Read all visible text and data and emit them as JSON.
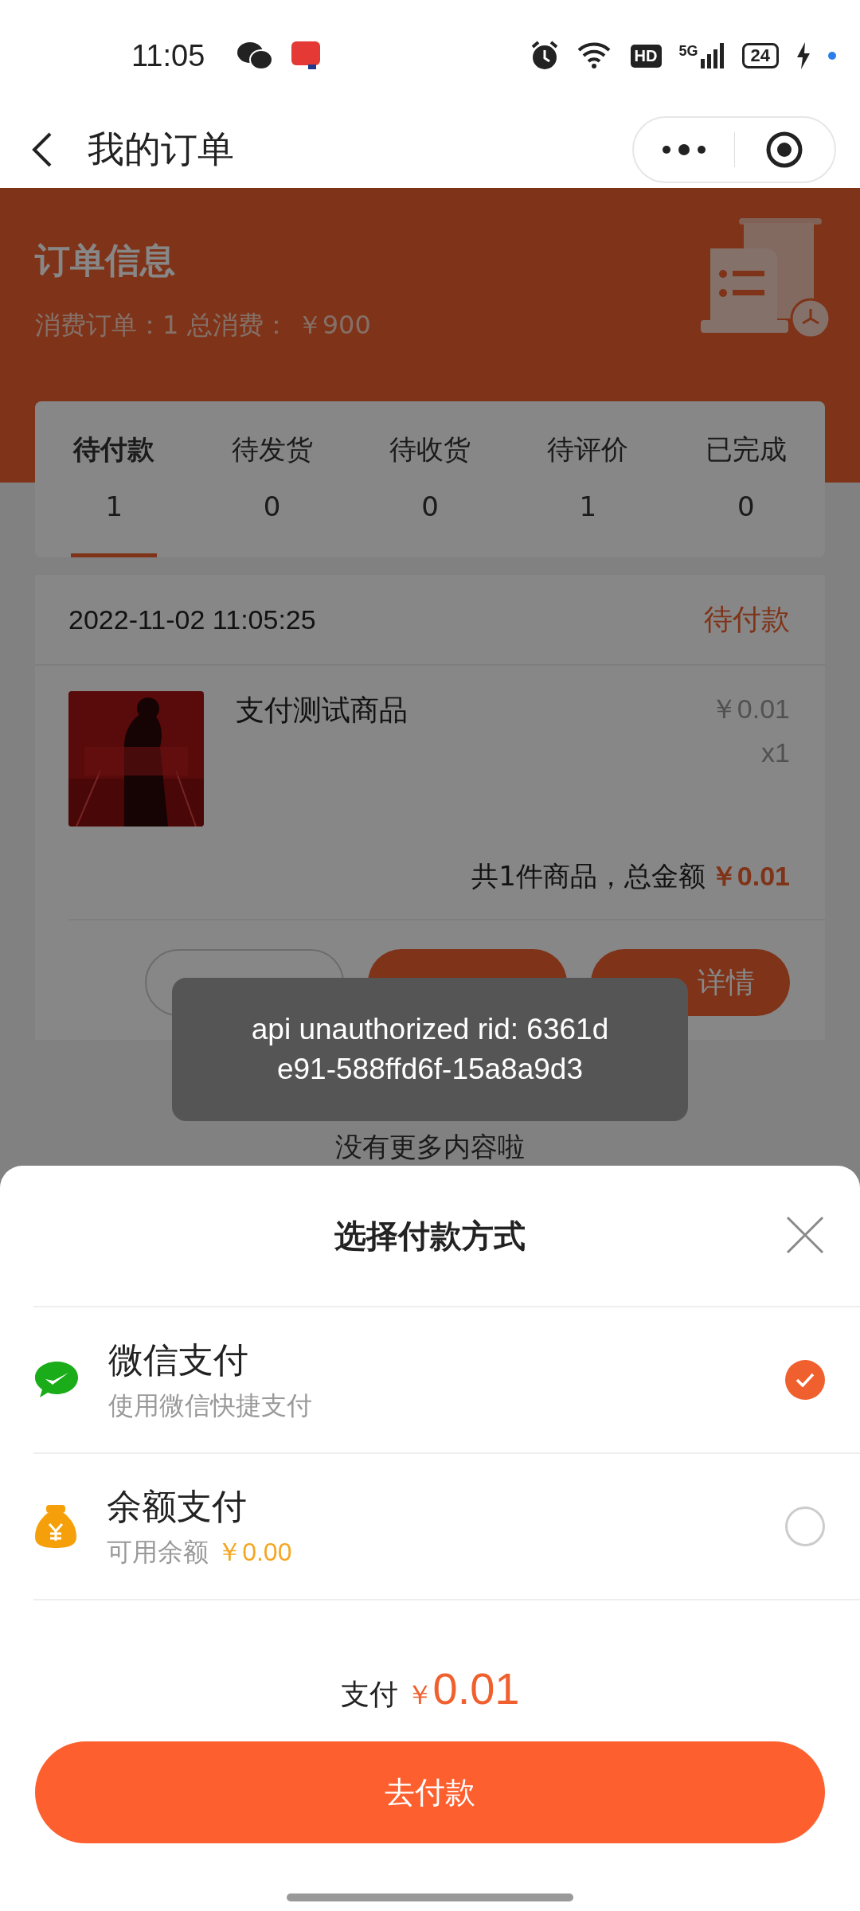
{
  "status_bar": {
    "time": "11:05",
    "hd": "HD",
    "network": "5G",
    "battery": "24"
  },
  "nav": {
    "title": "我的订单"
  },
  "summary": {
    "title": "订单信息",
    "stats": "消费订单：1 总消费： ￥900"
  },
  "tabs": [
    {
      "label": "待付款",
      "count": "1",
      "selected": true
    },
    {
      "label": "待发货",
      "count": "0",
      "selected": false
    },
    {
      "label": "待收货",
      "count": "0",
      "selected": false
    },
    {
      "label": "待评价",
      "count": "1",
      "selected": false
    },
    {
      "label": "已完成",
      "count": "0",
      "selected": false
    }
  ],
  "order": {
    "time": "2022-11-02 11:05:25",
    "status": "待付款",
    "item": {
      "kind": "picture",
      "name": "支付测试商品",
      "price": "￥0.01",
      "quantity": "x1"
    },
    "total_label": "共1件商品，总金额",
    "total": "￥0.01",
    "buttons": [
      {
        "kind": "outline"
      },
      {
        "kind": "filled"
      },
      {
        "kind": "filled",
        "label": "详情"
      }
    ]
  },
  "footer_note": "没有更多内容啦",
  "toast": "api unauthorized rid: 6361d\ne91-588ffd6f-15a8a9d3",
  "sheet": {
    "title": "选择付款方式",
    "methods": [
      {
        "kind": "wechat",
        "name": "微信支付",
        "note": "使用微信快捷支付",
        "selected": true
      },
      {
        "kind": "balance",
        "name": "余额支付",
        "note": "可用余额",
        "amount": "￥0.00",
        "selected": false
      }
    ],
    "pay_label": "支付",
    "pay_currency": "￥",
    "pay_amount": "0.01",
    "submit": "去付款"
  }
}
